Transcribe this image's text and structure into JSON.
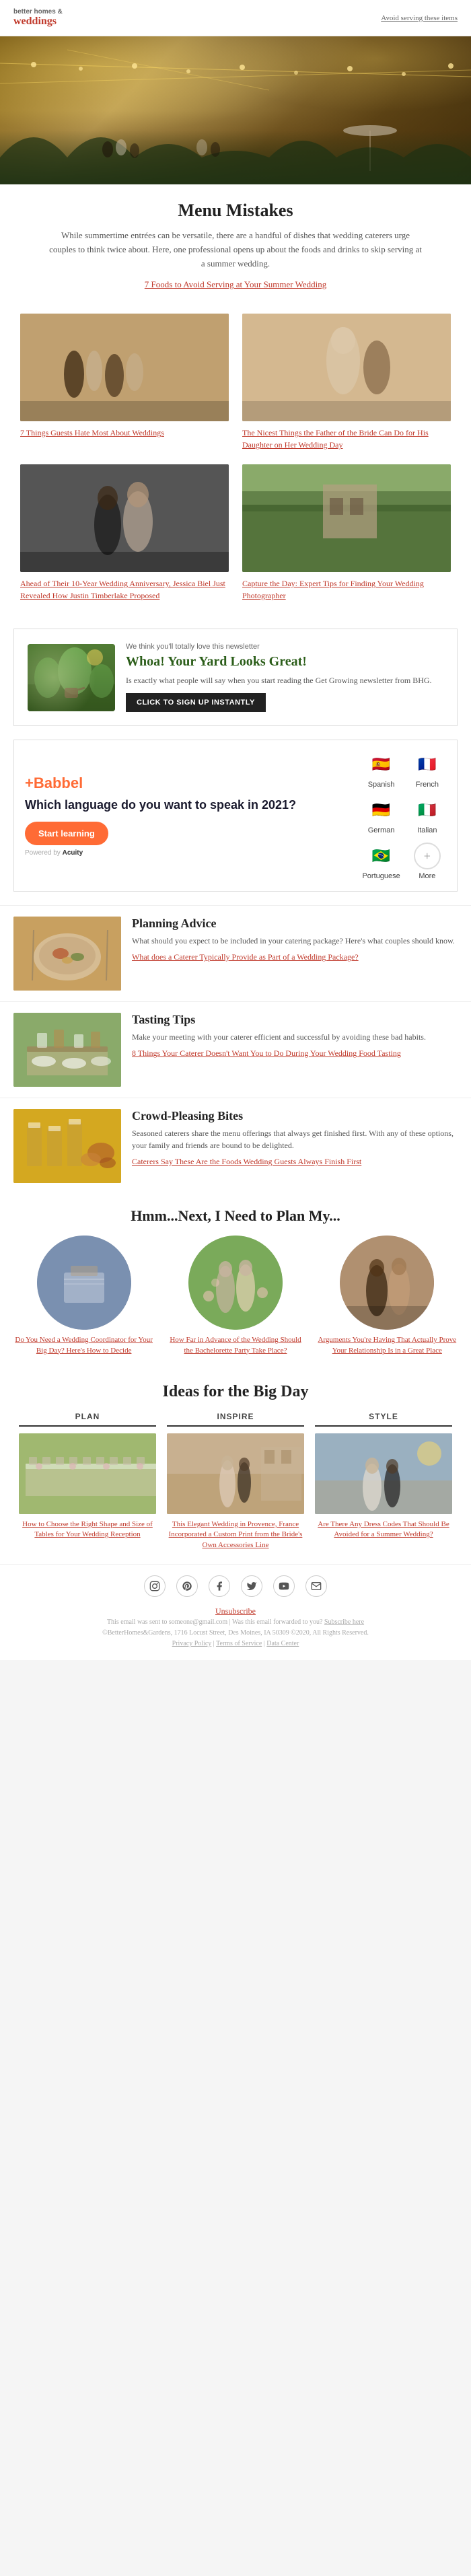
{
  "header": {
    "logo_top": "better homes &",
    "logo_bottom": "weddings",
    "avoid_link": "Avoid serving these items"
  },
  "hero": {
    "alt": "Outdoor wedding reception with string lights"
  },
  "menu_mistakes": {
    "title": "Menu Mistakes",
    "body": "While summertime entrées can be versatile, there are a handful of dishes that wedding caterers urge couples to think twice about. Here, one professional opens up about the foods and drinks to skip serving at a summer wedding.",
    "link_text": "7 Foods to Avoid Serving at Your Summer Wedding"
  },
  "article_cards": [
    {
      "link": "7 Things Guests Hate Most About Weddings",
      "image_class": "img-wedding-guests"
    },
    {
      "link": "The Nicest Things the Father of the Bride Can Do for His Daughter on Her Wedding Day",
      "image_class": "img-father-bride"
    },
    {
      "link": "Ahead of Their 10-Year Wedding Anniversary, Jessica Biel Just Revealed How Justin Timberlake Proposed",
      "image_class": "img-anniversary"
    },
    {
      "link": "Capture the Day: Expert Tips for Finding Your Wedding Photographer",
      "image_class": "img-photographer"
    }
  ],
  "newsletter_promo": {
    "tagline": "We think you'll totally love this newsletter",
    "title": "Whoa! Your Yard Looks Great!",
    "body": "Is exactly what people will say when you start reading the Get Growing newsletter from BHG.",
    "button": "CLICK TO SIGN UP INSTANTLY"
  },
  "ad": {
    "logo": "+Babbel",
    "heading": "Which language do you want to speak in 2021?",
    "button": "Start learning",
    "powered_by": "Powered by",
    "languages": [
      {
        "name": "Spanish",
        "flag": "🇪🇸"
      },
      {
        "name": "French",
        "flag": "🇫🇷"
      },
      {
        "name": "German",
        "flag": "🇩🇪"
      },
      {
        "name": "Italian",
        "flag": "🇮🇹"
      },
      {
        "name": "Portuguese",
        "flag": "🇧🇷"
      },
      {
        "name": "More",
        "flag": "+"
      }
    ]
  },
  "content_rows": [
    {
      "title": "Planning Advice",
      "body": "What should you expect to be included in your catering package? Here's what couples should know.",
      "link": "What does a Caterer Typically Provide as Part of a Wedding Package?",
      "thumb_class": "thumb-food"
    },
    {
      "title": "Tasting Tips",
      "body": "Make your meeting with your caterer efficient and successful by avoiding these bad habits.",
      "link": "8 Things Your Caterer Doesn't Want You to Do During Your Wedding Food Tasting",
      "thumb_class": "thumb-tasting"
    },
    {
      "title": "Crowd-Pleasing Bites",
      "body": "Seasoned caterers share the menu offerings that always get finished first. With any of these options, your family and friends are bound to be delighted.",
      "link": "Caterers Say These Are the Foods Wedding Guests Always Finish First",
      "thumb_class": "thumb-crowd"
    }
  ],
  "next_plan": {
    "title": "Hmm...Next, I Need to Plan My...",
    "items": [
      {
        "link": "Do You Need a Wedding Coordinator for Your Big Day? Here's How to Decide",
        "circle_class": "circle-1"
      },
      {
        "link": "How Far in Advance of the Wedding Should the Bachelorette Party Take Place?",
        "circle_class": "circle-2"
      },
      {
        "link": "Arguments You're Having That Actually Prove Your Relationship Is in a Great Place",
        "circle_class": "circle-3"
      }
    ]
  },
  "big_day": {
    "title": "Ideas for the Big Day",
    "columns": [
      {
        "heading": "PLAN",
        "thumb_class": "bd-plan",
        "link": "How to Choose the Right Shape and Size of Tables for Your Wedding Reception"
      },
      {
        "heading": "INSPIRE",
        "thumb_class": "bd-inspire",
        "link": "This Elegant Wedding in Provence, France Incorporated a Custom Print from the Bride's Own Accessories Line"
      },
      {
        "heading": "STYLE",
        "thumb_class": "bd-style",
        "link": "Are There Any Dress Codes That Should Be Avoided for a Summer Wedding?"
      }
    ]
  },
  "social": {
    "icons": [
      "instagram",
      "pinterest",
      "facebook",
      "twitter",
      "youtube",
      "email"
    ],
    "unsubscribe": "Unsubscribe",
    "footer_line1": "This email was sent to someone@gmail.com | Was this email forwarded to you?",
    "footer_subscribe": "Subscribe here",
    "footer_line2": "©BetterHomes&Gardens, 1716 Locust Street, Des Moines, IA 50309 ©2020, All Rights Reserved.",
    "privacy": "Privacy Policy",
    "terms": "Terms of Service",
    "data_link": "Data Center"
  }
}
